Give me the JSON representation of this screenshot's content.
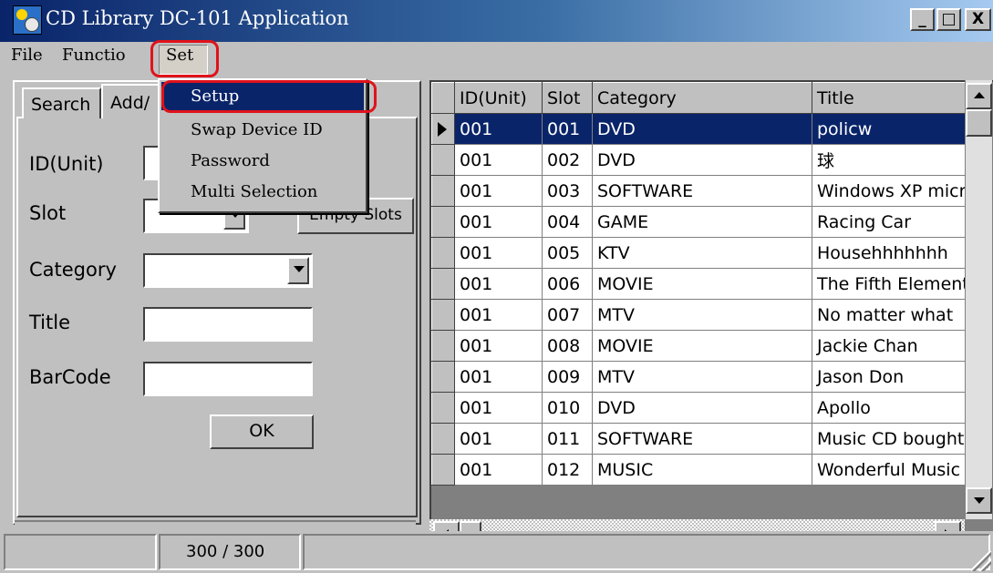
{
  "window": {
    "title": "CD Library DC-101 Application",
    "minimize_glyph": "_",
    "maximize_glyph": "□",
    "close_glyph": "X"
  },
  "menubar": {
    "file": "File",
    "function": "Functio",
    "set": "Set"
  },
  "set_menu": {
    "items": [
      "Setup",
      "Swap Device ID",
      "Password",
      "Multi Selection"
    ],
    "selected": "Setup",
    "highlight_color": "#e0121b"
  },
  "left_panel": {
    "tabs": [
      "Search",
      "Add/"
    ],
    "labels": {
      "id_unit": "ID(Unit)",
      "slot": "Slot",
      "category": "Category",
      "title": "Title",
      "barcode": "BarCode"
    },
    "empty_slots_button": "Empty Slots",
    "ok_button": "OK"
  },
  "grid": {
    "columns": [
      "ID(Unit)",
      "Slot",
      "Category",
      "Title"
    ],
    "rows": [
      [
        "001",
        "001",
        "DVD",
        "policw"
      ],
      [
        "001",
        "002",
        "DVD",
        "球"
      ],
      [
        "001",
        "003",
        "SOFTWARE",
        "Windows XP micr"
      ],
      [
        "001",
        "004",
        "GAME",
        "Racing Car"
      ],
      [
        "001",
        "005",
        "KTV",
        "Househhhhhhh"
      ],
      [
        "001",
        "006",
        "MOVIE",
        "The Fifth Element"
      ],
      [
        "001",
        "007",
        "MTV",
        "No matter what"
      ],
      [
        "001",
        "008",
        "MOVIE",
        "Jackie Chan"
      ],
      [
        "001",
        "009",
        "MTV",
        "Jason Don"
      ],
      [
        "001",
        "010",
        "DVD",
        "Apollo"
      ],
      [
        "001",
        "011",
        "SOFTWARE",
        "Music CD bought"
      ],
      [
        "001",
        "012",
        "MUSIC",
        "Wonderful Music"
      ]
    ],
    "selected_row": 0,
    "selection_color": "#0a246a"
  },
  "statusbar": {
    "panel1": "",
    "panel2": "300 / 300",
    "panel3": ""
  }
}
